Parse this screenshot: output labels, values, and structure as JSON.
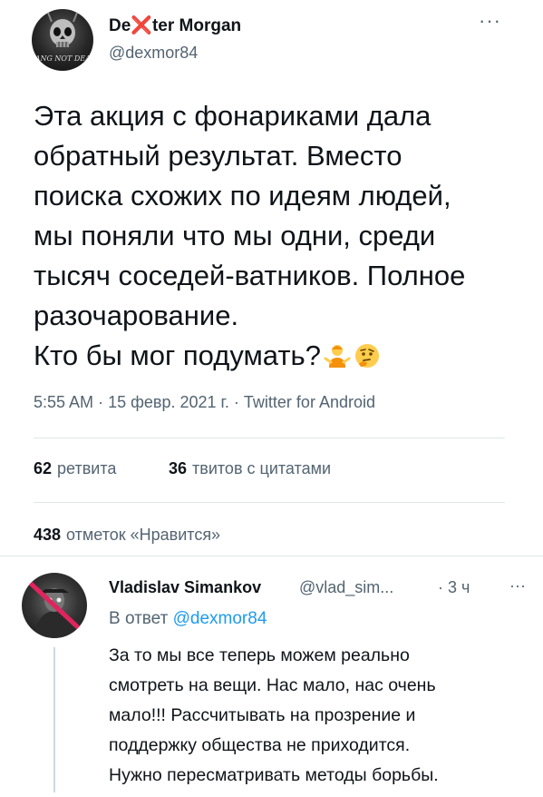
{
  "tweet": {
    "author_name": "De❌ter Morgan",
    "author_handle": "@dexmor84",
    "avatar_caption": "HANG NOT DEAD",
    "text": "Эта акция с фонариками дала\nобратный результат. Вместо\nпоиска схожих по идеям людей,\nмы поняли что мы одни, среди\nтысяч соседей-ватников. Полное\nразочарование.\nКто бы мог подумать?",
    "time": "5:55 AM",
    "date": "15 февр. 2021 г.",
    "source": "Twitter for Android",
    "retweets": {
      "count": "62",
      "label": "ретвита"
    },
    "quotes": {
      "count": "36",
      "label": "твитов с цитатами"
    },
    "likes": {
      "count": "438",
      "label": "отметок «Нравится»"
    },
    "more_icon": "more-horizontal-icon"
  },
  "reply": {
    "author_name": "Vladislav Simankov",
    "author_handle": "@vlad_sim...",
    "time": "3 ч",
    "reply_prefix": "В ответ",
    "reply_mention": "@dexmor84",
    "text": "За то мы все теперь можем реально\nсмотреть на вещи. Нас мало, нас очень\nмало!!! Рассчитывать на прозрение и\nподдержку общества не приходится.\nНужно пересматривать методы борьбы."
  },
  "colors": {
    "text_primary": "#0f1419",
    "text_secondary": "#536471",
    "link": "#1d9bf0",
    "divider": "#e1e6ea",
    "cross_red": "#e0245e"
  }
}
